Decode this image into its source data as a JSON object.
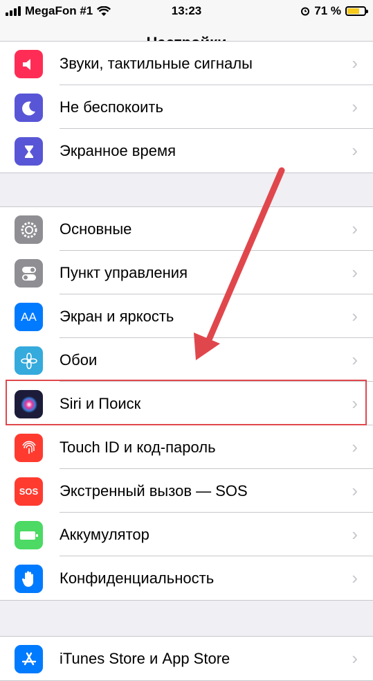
{
  "status_bar": {
    "carrier": "MegaFon #1",
    "time": "13:23",
    "battery_percent": "71 %",
    "battery_level": 0.71,
    "battery_color": "#f6c91b"
  },
  "nav": {
    "title": "Настройки"
  },
  "groups": [
    {
      "items": [
        {
          "label": "Звуки, тактильные сигналы",
          "icon": "speaker-icon",
          "color": "#ff2d55"
        },
        {
          "label": "Не беспокоить",
          "icon": "moon-icon",
          "color": "#5856d6"
        },
        {
          "label": "Экранное время",
          "icon": "hourglass-icon",
          "color": "#5856d6"
        }
      ]
    },
    {
      "items": [
        {
          "label": "Основные",
          "icon": "gear-icon",
          "color": "#8e8e93"
        },
        {
          "label": "Пункт управления",
          "icon": "toggles-icon",
          "color": "#8e8e93"
        },
        {
          "label": "Экран и яркость",
          "icon": "text-size-icon",
          "color": "#007aff",
          "glyph": "AA"
        },
        {
          "label": "Обои",
          "icon": "flower-icon",
          "color": "#35aadc"
        },
        {
          "label": "Siri и Поиск",
          "icon": "siri-icon",
          "color": "#1c1c3a"
        },
        {
          "label": "Touch ID и код-пароль",
          "icon": "fingerprint-icon",
          "color": "#ff3b30"
        },
        {
          "label": "Экстренный вызов — SOS",
          "icon": "sos-icon",
          "color": "#ff3b30",
          "glyph": "SOS"
        },
        {
          "label": "Аккумулятор",
          "icon": "battery-icon",
          "color": "#4cd964"
        },
        {
          "label": "Конфиденциальность",
          "icon": "hand-icon",
          "color": "#007aff"
        }
      ]
    },
    {
      "items": [
        {
          "label": "iTunes Store и App Store",
          "icon": "app-store-icon",
          "color": "#007aff"
        }
      ]
    }
  ],
  "annotation": {
    "highlighted_item": "Siri и Поиск",
    "color": "#e0474c"
  }
}
